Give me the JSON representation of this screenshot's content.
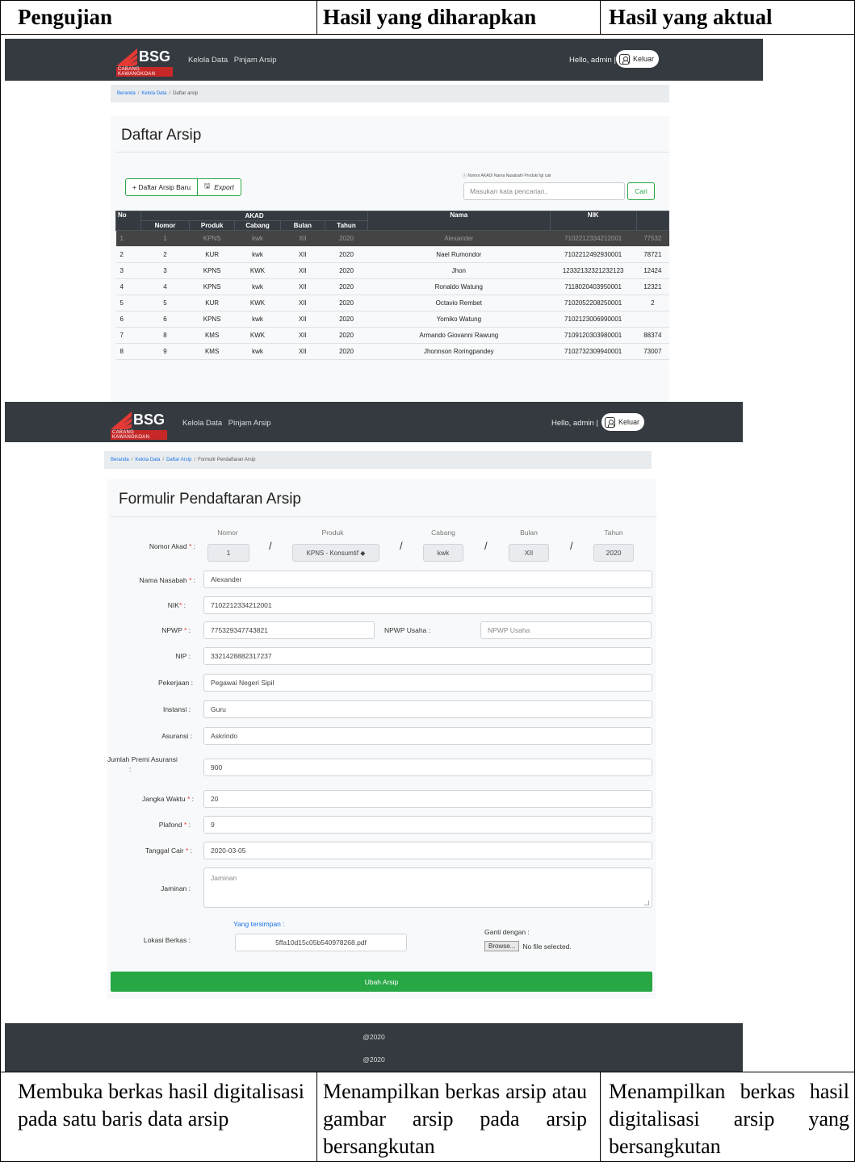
{
  "doc": {
    "headers": [
      "Pengujian",
      "Hasil yang diharapkan",
      "Hasil yang aktual"
    ],
    "descriptions": [
      "Membuka berkas hasil digitalisasi pada satu baris data arsip",
      "Menampilkan berkas arsip atau gambar arsip pada arsip bersangkutan",
      "Menampilkan berkas hasil digitalisasi arsip yang bersangkutan"
    ]
  },
  "app": {
    "logo": "BSG",
    "logo_sub": "CABANG KAWANGKOAN",
    "nav": [
      "Kelola Data",
      "Pinjam Arsip"
    ],
    "hello": "Hello, admin |",
    "logout": "Keluar",
    "colors": {
      "navbar": "#343a40",
      "accent": "#28a745",
      "link": "#1a73e8"
    }
  },
  "list_page": {
    "breadcrumb": [
      "Beranda",
      "Kelola Data",
      "Daftar arsip"
    ],
    "title": "Daftar Arsip",
    "new_button": "+ Daftar Arsip Baru",
    "export_button": "Export",
    "search_hint": "ⓘ Nomor AKAD/ Nama Nasabah/ Produk/ tgl cair",
    "search_placeholder": "Masukan kata pencarian..",
    "search_button": "Cari",
    "table": {
      "head_top": [
        "No",
        "AKAD",
        "Nama",
        "NIK"
      ],
      "head_sub": [
        "Nomor",
        "Produk",
        "Cabang",
        "Bulan",
        "Tahun"
      ],
      "rows": [
        {
          "no": "1",
          "nomor": "1",
          "produk": "KPNS",
          "cabang": "kwk",
          "bulan": "XII",
          "tahun": "2020",
          "nama": "Alexander",
          "nik": "7102212334212001",
          "extra": "77532"
        },
        {
          "no": "2",
          "nomor": "2",
          "produk": "KUR",
          "cabang": "kwk",
          "bulan": "XII",
          "tahun": "2020",
          "nama": "Nael Rumondor",
          "nik": "7102212492930001",
          "extra": "78721"
        },
        {
          "no": "3",
          "nomor": "3",
          "produk": "KPNS",
          "cabang": "KWK",
          "bulan": "XII",
          "tahun": "2020",
          "nama": "Jhon",
          "nik": "1233213232123212​3",
          "extra": "12424"
        },
        {
          "no": "4",
          "nomor": "4",
          "produk": "KPNS",
          "cabang": "kwk",
          "bulan": "XII",
          "tahun": "2020",
          "nama": "Ronaldo Watung",
          "nik": "7118020403950001",
          "extra": "12321"
        },
        {
          "no": "5",
          "nomor": "5",
          "produk": "KUR",
          "cabang": "KWK",
          "bulan": "XII",
          "tahun": "2020",
          "nama": "Octavio Rembet",
          "nik": "7102052208250001",
          "extra": "2"
        },
        {
          "no": "6",
          "nomor": "6",
          "produk": "KPNS",
          "cabang": "kwk",
          "bulan": "XII",
          "tahun": "2020",
          "nama": "Yomiko Watung",
          "nik": "7102123006990001",
          "extra": ""
        },
        {
          "no": "7",
          "nomor": "8",
          "produk": "KMS",
          "cabang": "KWK",
          "bulan": "XII",
          "tahun": "2020",
          "nama": "Armando Giovanni Rawung",
          "nik": "7109120303980001",
          "extra": "88374"
        },
        {
          "no": "8",
          "nomor": "9",
          "produk": "KMS",
          "cabang": "kwk",
          "bulan": "XII",
          "tahun": "2020",
          "nama": "Jhonnson Roringpandey",
          "nik": "7102732309940001",
          "extra": "73007"
        }
      ]
    }
  },
  "form_page": {
    "breadcrumb": [
      "Beranda",
      "Kelola Data",
      "Daftar Arsip",
      "Formulir Pendaftaran Arsip"
    ],
    "title": "Formulir Pendaftaran Arsip",
    "akad_label": "Nomor Akad",
    "akad_cols": [
      "Nomor",
      "Produk",
      "Cabang",
      "Bulan",
      "Tahun"
    ],
    "akad_values": [
      "1",
      "KPNS - Konsumtif ◆",
      "kwk",
      "XII",
      "2020"
    ],
    "fields": {
      "nama_label": "Nama Nasabah",
      "nama": "Alexander",
      "nik_label": "NIK",
      "nik": "7102212334212001",
      "npwp_label": "NPWP",
      "npwp": "775329347743821",
      "npwp_usaha_label": "NPWP Usaha :",
      "npwp_usaha_ph": "NPWP Usaha",
      "nip_label": "NIP :",
      "nip": "3321428882317237",
      "pekerjaan_label": "Pekerjaan :",
      "pekerjaan": "Pegawai Negeri Sipil",
      "instansi_label": "Instansi :",
      "instansi": "Guru",
      "asuransi_label": "Asuransi :",
      "asuransi": "Askrindo",
      "premi_label": "Jumlah Premi Asuransi",
      "premi_colon": ":",
      "premi": "900",
      "jangka_label": "Jangka Waktu",
      "jangka": "20",
      "plafond_label": "Plafond",
      "plafond": "9",
      "tgl_label": "Tanggal Cair",
      "tgl": "2020-03-05",
      "jaminan_label": "Jaminan :",
      "jaminan_ph": "Jaminan",
      "lokasi_label": "Lokasi Berkas :",
      "saved_label": "Yang tersimpan :",
      "saved_file": "5ffa10d15c05b540978268.pdf",
      "ganti_label": "Ganti dengan :",
      "browse": "Browse...",
      "no_file": "No file selected."
    },
    "submit": "Ubah Arsip",
    "footer": [
      "@2020",
      "@2020"
    ]
  }
}
